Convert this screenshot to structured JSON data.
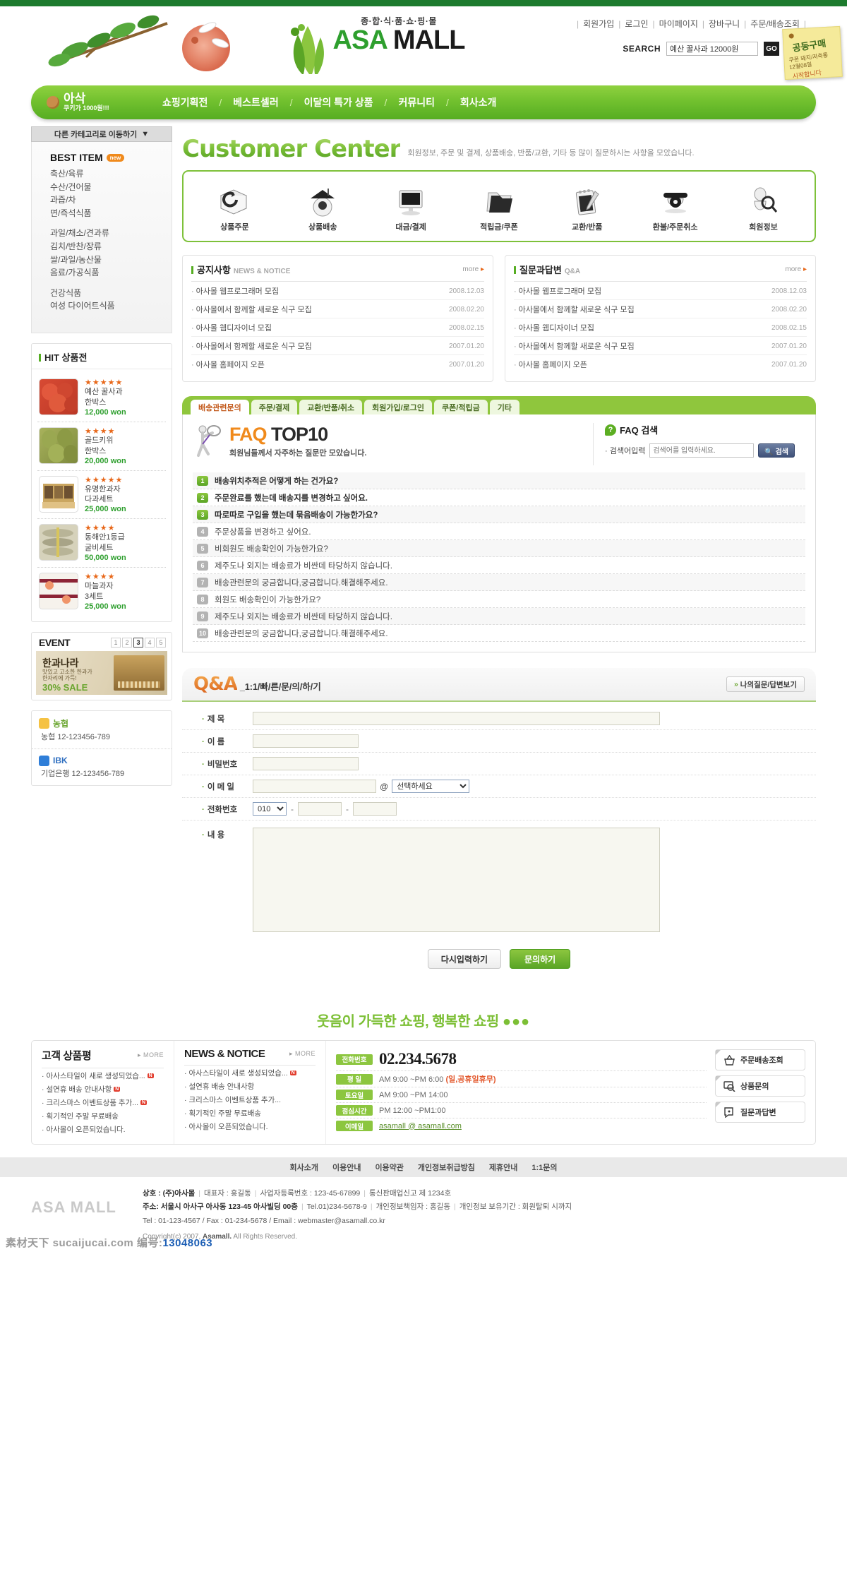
{
  "header": {
    "brand_sub": "종·합·식·품·쇼·핑·몰",
    "brand_asa": "ASA",
    "brand_mall": "MALL",
    "top_links": [
      "회원가입",
      "로그인",
      "마이페이지",
      "장바구니",
      "주문/배송조회"
    ],
    "search_label": "SEARCH",
    "search_value": "예산 꿀사과 12000원",
    "search_go": "GO",
    "memo_line1": "공동구매",
    "memo_line2": "쿠폰 돼지/저축통",
    "memo_line3": "12월08일",
    "memo_line4": "시작합니다"
  },
  "nav": {
    "logo_main": "아삭",
    "logo_sub": "쿠키가 1000원!!!",
    "items": [
      "쇼핑기획전",
      "베스트셀러",
      "이달의 특가 상품",
      "커뮤니티",
      "회사소개"
    ]
  },
  "sidebar": {
    "category_select": "다른 카테고리로 이동하기",
    "best_item": "BEST ITEM",
    "new_badge": "new",
    "cat_group1": [
      "축산/육류",
      "수산/건어물",
      "과즙/차",
      "면/즉석식품"
    ],
    "cat_group2": [
      "과일/채소/견과류",
      "김치/반찬/장류",
      "쌀/과일/농산물",
      "음료/가공식품"
    ],
    "cat_group3": [
      "건강식품",
      "여성 다이어트식품"
    ],
    "hit_title": "HIT 상품전",
    "hit_items": [
      {
        "name1": "예산 꿀사과",
        "name2": "한박스",
        "price": "12,000 won",
        "stars": "★★★★★",
        "c1": "#d84a33",
        "c2": "#bb3826"
      },
      {
        "name1": "골드키위",
        "name2": "한박스",
        "price": "20,000 won",
        "stars": "★★★★",
        "c1": "#a8b25c",
        "c2": "#7e8a3e"
      },
      {
        "name1": "유명한과자",
        "name2": "다과세트",
        "price": "25,000 won",
        "stars": "★★★★★",
        "c1": "#d9c084",
        "c2": "#a8833c"
      },
      {
        "name1": "동해안1등급",
        "name2": "굴비세트",
        "price": "50,000 won",
        "stars": "★★★★",
        "c1": "#c8c29a",
        "c2": "#9a9066"
      },
      {
        "name1": "마늘과자",
        "name2": "3세트",
        "price": "25,000 won",
        "stars": "★★★★",
        "c1": "#f3ece4",
        "c2": "#d9cfc2"
      }
    ],
    "event_title": "EVENT",
    "event_pages": [
      "1",
      "2",
      "3",
      "4",
      "5"
    ],
    "event_active_page": "3",
    "event_banner_title": "한과나라",
    "event_banner_line1": "맛있고 고소한 한과가",
    "event_banner_line2": "한자리에 가득!",
    "event_banner_sale": "30% SALE",
    "banks": [
      {
        "logo": "농협",
        "name": "농협",
        "account": "12-123456-789"
      },
      {
        "logo": "IBK",
        "name": "기업은행",
        "account": "12-123456-789"
      }
    ]
  },
  "page": {
    "title": "Customer Center",
    "subtitle": "회원정보, 주문 및 결제, 상품배송, 반품/교환, 기타 등 많이 질문하시는 사항을 모았습니다."
  },
  "service_icons": [
    {
      "label": "상품주문",
      "icon": "envelope-refresh-icon"
    },
    {
      "label": "상품배송",
      "icon": "house-delivery-icon"
    },
    {
      "label": "대금/결제",
      "icon": "monitor-icon"
    },
    {
      "label": "적립금/쿠폰",
      "icon": "folder-icon"
    },
    {
      "label": "교환/반품",
      "icon": "notepad-pen-icon"
    },
    {
      "label": "환불/주문취소",
      "icon": "telephone-icon"
    },
    {
      "label": "회원정보",
      "icon": "person-search-icon"
    }
  ],
  "notice": {
    "title_ko": "공지사항",
    "title_en": "NEWS & NOTICE",
    "more": "more",
    "rows": [
      {
        "text": "아사몰 웹프로그래머 모집",
        "date": "2008.12.03"
      },
      {
        "text": "아사몰에서 함께할 새로운 식구 모집",
        "date": "2008.02.20"
      },
      {
        "text": "아사몰 웹디자이너 모집",
        "date": "2008.02.15"
      },
      {
        "text": "아사몰에서 함께할 새로운 식구 모집",
        "date": "2007.01.20"
      },
      {
        "text": "아사몰 홈페이지 오픈",
        "date": "2007.01.20"
      }
    ]
  },
  "qna_box": {
    "title_ko": "질문과답변",
    "title_en": "Q&A",
    "more": "more",
    "rows": [
      {
        "text": "아사몰 웹프로그래머 모집",
        "date": "2008.12.03"
      },
      {
        "text": "아사몰에서 함께할 새로운 식구 모집",
        "date": "2008.02.20"
      },
      {
        "text": "아사몰 웹디자이너 모집",
        "date": "2008.02.15"
      },
      {
        "text": "아사몰에서 함께할 새로운 식구 모집",
        "date": "2007.01.20"
      },
      {
        "text": "아사몰 홈페이지 오픈",
        "date": "2007.01.20"
      }
    ]
  },
  "faq": {
    "tabs": [
      "배송관련문의",
      "주문/결제",
      "교환/반품/취소",
      "회원가입/로그인",
      "쿠폰/적립금",
      "기타"
    ],
    "active_tab": "배송관련문의",
    "title_f": "FAQ",
    "title_t": "TOP10",
    "subtitle": "회원님들께서 자주하는 질문만 모았습니다.",
    "search_title": "FAQ 검색",
    "search_label": "검색어입력",
    "search_placeholder": "검색어를 입력하세요.",
    "search_button": "검색",
    "items": [
      {
        "num": "1",
        "text": "배송위치추적은 어떻게 하는 건가요?",
        "hot": true
      },
      {
        "num": "2",
        "text": "주문완료를 했는데 배송지를 변경하고 싶어요.",
        "hot": true
      },
      {
        "num": "3",
        "text": "따로따로 구입을 했는데 묶음배송이 가능한가요?",
        "hot": true
      },
      {
        "num": "4",
        "text": "주문상품을 변경하고 싶어요.",
        "hot": false
      },
      {
        "num": "5",
        "text": "비회원도 배송확인이 가능한가요?",
        "hot": false
      },
      {
        "num": "6",
        "text": "제주도나 외지는 배송료가 비싼데 타당하지 않습니다.",
        "hot": false
      },
      {
        "num": "7",
        "text": "배송관련문의 궁금합니다,궁금합니다.해결해주세요.",
        "hot": false
      },
      {
        "num": "8",
        "text": "회원도 배송확인이 가능한가요?",
        "hot": false
      },
      {
        "num": "9",
        "text": "제주도나 외지는 배송료가 비싼데 타당하지 않습니다.",
        "hot": false
      },
      {
        "num": "10",
        "text": "배송관련문의 궁금합니다,궁금합니다.해결해주세요.",
        "hot": false
      }
    ]
  },
  "qna_form": {
    "title": "Q&A",
    "slug": "_1:1/빠/른/문/의/하/기",
    "my_button": "나의질문/답변보기",
    "label_subject": "제  목",
    "label_name": "이  름",
    "label_password": "비밀번호",
    "label_email": "이 메 일",
    "label_phone": "전화번호",
    "label_content": "내  용",
    "value_subject": "",
    "value_name": "",
    "value_password": "",
    "value_email": "",
    "email_domain_selected": "선택하세요",
    "phone_prefix_selected": "010",
    "value_phone2": "",
    "value_phone3": "",
    "value_content": "",
    "btn_reset": "다시입력하기",
    "btn_submit": "문의하기"
  },
  "bottom": {
    "slogan": "웃음이 가득한 쇼핑, 행복한 쇼핑",
    "slogan_dots": "●●●",
    "reviews_title": "고객 상품평",
    "more": "MORE",
    "reviews": [
      {
        "text": "아사스타일이 새로 생성되었습...",
        "new": true
      },
      {
        "text": "설연휴 배송 안내사항",
        "new": true
      },
      {
        "text": "크리스마스 이벤트상품 추가...",
        "new": true
      },
      {
        "text": "획기적인 주말 무료배송",
        "new": false
      },
      {
        "text": "아사몰이 오픈되었습니다.",
        "new": false
      }
    ],
    "news_title": "NEWS & NOTICE",
    "news": [
      {
        "text": "아사스타일이 새로 생성되었습...",
        "new": true
      },
      {
        "text": "설연휴 배송 안내사항",
        "new": false
      },
      {
        "text": "크리스마스 이벤트상품 추가...",
        "new": false
      },
      {
        "text": "획기적인 주말 무료배송",
        "new": false
      },
      {
        "text": "아사몰이 오픈되었습니다.",
        "new": false
      }
    ],
    "contact": {
      "tag_phone": "전화번호",
      "phone": "02.234.5678",
      "tag_weekday": "평   일",
      "weekday": "AM 9:00 ~PM 6:00 ",
      "weekday_holiday": "(일,공휴일휴무)",
      "tag_saturday": "토요일",
      "saturday": "AM 9:00 ~PM 14:00",
      "tag_lunch": "점심시간",
      "lunch": "PM 12:00 ~PM1:00",
      "tag_email": "이메일",
      "email": "asamall @ asamall.com"
    },
    "quick_buttons": [
      {
        "label": "주문배송조회",
        "icon": "basket-icon"
      },
      {
        "label": "상품문의",
        "icon": "monitor-search-icon"
      },
      {
        "label": "질문과답변",
        "icon": "speech-bubble-icon"
      }
    ]
  },
  "footer": {
    "links": [
      "회사소개",
      "이용안내",
      "이용약관",
      "개인정보취급방침",
      "제휴안내",
      "1:1문의"
    ],
    "logo": "ASA MALL",
    "line1_a": "상호 : (주)아사몰",
    "line1_b": "대표자 : 홍길동",
    "line1_c": "사업자등록번호 : 123-45-67899",
    "line1_d": "통신판매업신고 제 1234호",
    "line2_a": "주소: 서울시 아사구 아사동 123-45 아사빌딩 00층",
    "line2_b": "Tel.01)234-5678-9",
    "line2_c": "개인정보책임자 : 홍길동",
    "line2_d": "개인정보 보유기간 : 회원탈퇴 시까지",
    "line3": "Tel : 01-123-4567  /  Fax : 01-234-5678  /  Email : webmaster@asamall.co.kr",
    "copyright_a": "Copyright(c) 2007,",
    "copyright_b": "Asamall.",
    "copyright_c": "All Rights Reserved."
  },
  "watermark": {
    "site": "素材天下 sucaijucai.com",
    "label": "编号:",
    "number": "13048063"
  }
}
